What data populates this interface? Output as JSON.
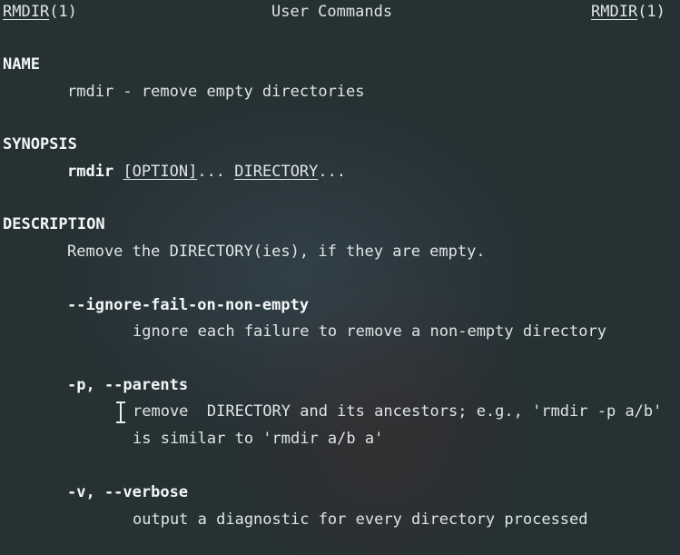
{
  "header": {
    "left": "RMDIR",
    "left_suffix": "(1)",
    "center": "User Commands",
    "right": "RMDIR",
    "right_suffix": "(1)"
  },
  "name_section": {
    "heading": "NAME",
    "text": "rmdir - remove empty directories"
  },
  "synopsis_section": {
    "heading": "SYNOPSIS",
    "command": "rmdir",
    "sep1": " ",
    "option": "[OPTION]",
    "sep2": "... ",
    "directory": "DIRECTORY",
    "tail": "..."
  },
  "description_section": {
    "heading": "DESCRIPTION",
    "intro": "Remove the DIRECTORY(ies), if they are empty.",
    "options": [
      {
        "flag": "--ignore-fail-on-non-empty",
        "desc_lines": [
          "ignore each failure to remove a non-empty directory"
        ]
      },
      {
        "flag": "-p, --parents",
        "desc_lines": [
          "remove  DIRECTORY and its ancestors; e.g., 'rmdir -p a/b'",
          "is similar to 'rmdir a/b a'"
        ]
      },
      {
        "flag": "-v, --verbose",
        "desc_lines": [
          "output a diagnostic for every directory processed"
        ]
      }
    ]
  },
  "cursor_icon": "text-cursor-ibeam-icon"
}
